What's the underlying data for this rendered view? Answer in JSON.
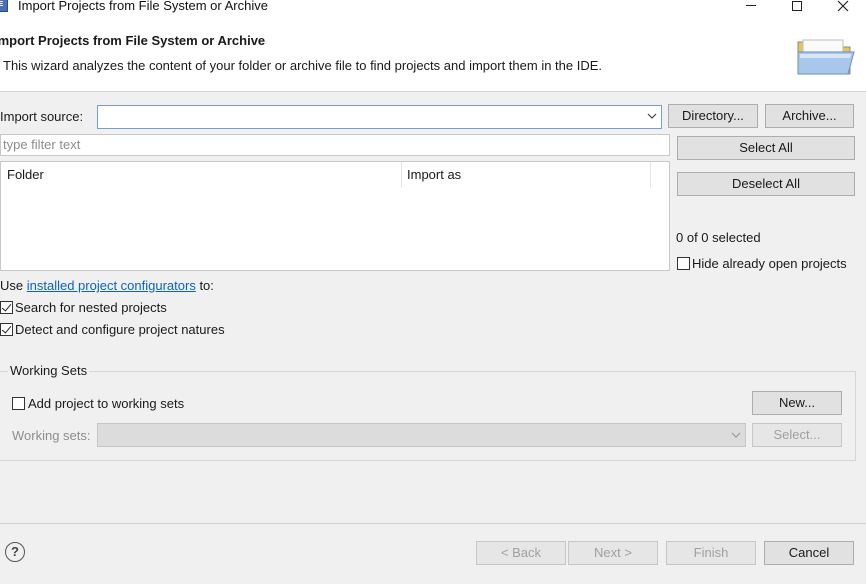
{
  "window": {
    "title": "Import Projects from File System or Archive",
    "icon_text": "E"
  },
  "banner": {
    "title": "Import Projects from File System or Archive",
    "description": "This wizard analyzes the content of your folder or archive file to find projects and import them in the IDE.",
    "image": "folder-icon"
  },
  "import_source": {
    "label": "Import source:",
    "value": "",
    "directory_button": "Directory...",
    "archive_button": "Archive..."
  },
  "filter": {
    "placeholder": "type filter text"
  },
  "table": {
    "columns": [
      "Folder",
      "Import as"
    ],
    "rows": []
  },
  "selection": {
    "select_all": "Select All",
    "deselect_all": "Deselect All",
    "count_text": "0 of 0 selected",
    "hide_open_label": "Hide already open projects",
    "hide_open_checked": false
  },
  "configurators": {
    "prefix": "Use ",
    "link_text": "installed project configurators",
    "suffix": " to:"
  },
  "options": {
    "nested_label": "Search for nested projects",
    "nested_checked": true,
    "natures_label": "Detect and configure project natures",
    "natures_checked": true
  },
  "working_sets": {
    "group_title": "Working Sets",
    "add_label": "Add project to working sets",
    "add_checked": false,
    "new_button": "New...",
    "sets_label": "Working sets:",
    "select_button": "Select..."
  },
  "footer": {
    "help_glyph": "?",
    "back": "< Back",
    "next": "Next >",
    "finish": "Finish",
    "cancel": "Cancel"
  },
  "colors": {
    "link": "#0b62c4",
    "focus_border": "#7a9cc9",
    "folder_yellow": "#f2d37a"
  }
}
